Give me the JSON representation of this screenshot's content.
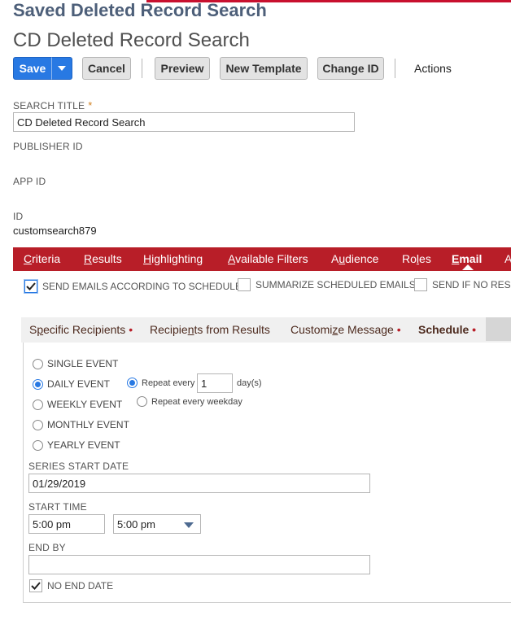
{
  "header": {
    "page_type": "Saved Deleted Record Search",
    "page_title": "CD Deleted Record Search"
  },
  "toolbar": {
    "save": "Save",
    "cancel": "Cancel",
    "preview": "Preview",
    "new_template": "New Template",
    "change_id": "Change ID",
    "actions": "Actions"
  },
  "form": {
    "search_title_label": "SEARCH TITLE",
    "required_mark": "*",
    "search_title_value": "CD Deleted Record Search",
    "publisher_id_label": "PUBLISHER ID",
    "app_id_label": "APP ID",
    "id_label": "ID",
    "id_value": "customsearch879"
  },
  "tabs": [
    {
      "u": "C",
      "rest": "riteria"
    },
    {
      "u": "R",
      "rest": "esults"
    },
    {
      "u": "H",
      "rest": "ighlighting"
    },
    {
      "u": "A",
      "rest": "vailable Filters"
    },
    {
      "pre": "A",
      "u": "u",
      "rest": "dience"
    },
    {
      "pre": "Ro",
      "u": "l",
      "rest": "es"
    },
    {
      "u": "E",
      "rest": "mail"
    },
    {
      "pre": "A",
      "u": "",
      "rest": ""
    }
  ],
  "email_options": {
    "send_schedule": "SEND EMAILS ACCORDING TO SCHEDULE",
    "summarize": "SUMMARIZE SCHEDULED EMAILS",
    "send_if_no": "SEND IF NO RESU"
  },
  "subtabs": {
    "specific_recipients_pre": "S",
    "specific_recipients_u": "p",
    "specific_recipients_rest": "ecific Recipients",
    "recipients_results_pre": "Recipie",
    "recipients_results_u": "n",
    "recipients_results_rest": "ts from Results",
    "customize_pre": "Customi",
    "customize_u": "z",
    "customize_rest": "e Message",
    "schedule": "Schedule",
    "dot": "•"
  },
  "schedule": {
    "single_event": "SINGLE EVENT",
    "daily_event": "DAILY EVENT",
    "weekly_event": "WEEKLY EVENT",
    "monthly_event": "MONTHLY EVENT",
    "yearly_event": "YEARLY EVENT",
    "repeat_every": "Repeat every",
    "repeat_value": "1",
    "days_unit": "day(s)",
    "repeat_weekday": "Repeat every weekday",
    "series_start_label": "SERIES START DATE",
    "series_start_value": "01/29/2019",
    "start_time_label": "START TIME",
    "start_time_value": "5:00 pm",
    "start_time_select": "5:00 pm",
    "end_by_label": "END BY",
    "end_by_value": "",
    "no_end_date": "NO END DATE"
  },
  "colors": {
    "tab_bar": "#b81e28",
    "primary_button": "#2879e3",
    "title_blue": "#4d5f79"
  }
}
